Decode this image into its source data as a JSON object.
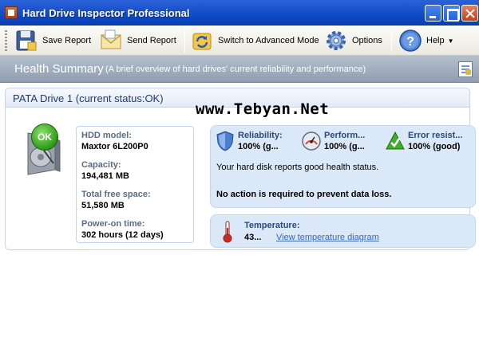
{
  "window": {
    "title": "Hard Drive Inspector Professional"
  },
  "toolbar": {
    "save_report": "Save Report",
    "send_report": "Send Report",
    "advanced_mode": "Switch to Advanced Mode",
    "options": "Options",
    "help": "Help"
  },
  "section": {
    "title": "Health Summary",
    "subtitle": "(A brief overview of hard drives' current reliability and performance)"
  },
  "drive": {
    "title": "PATA Drive 1 (current status:OK)",
    "status_badge": "OK",
    "model_label": "HDD model:",
    "model_value": "Maxtor 6L200P0",
    "capacity_label": "Capacity:",
    "capacity_value": "194,481 MB",
    "free_label": "Total free space:",
    "free_value": "51,580 MB",
    "power_label": "Power-on time:",
    "power_value": "302 hours (12 days)"
  },
  "watermark": "www.Tebyan.Net",
  "health": {
    "reliability_label": "Reliability:",
    "reliability_value": "100% (g...",
    "performance_label": "Perform...",
    "performance_value": "100% (g...",
    "error_label": "Error resist...",
    "error_value": "100% (good)",
    "message": "Your hard disk reports good health status.",
    "action": "No action is required to prevent data loss."
  },
  "temperature": {
    "label": "Temperature:",
    "value": "43...",
    "link": "View temperature diagram"
  },
  "colors": {
    "titlebar": "#0b47c4",
    "section_header": "#8f9db0",
    "panel_fill": "#dae8f7",
    "ok_green": "#2f9a18"
  }
}
